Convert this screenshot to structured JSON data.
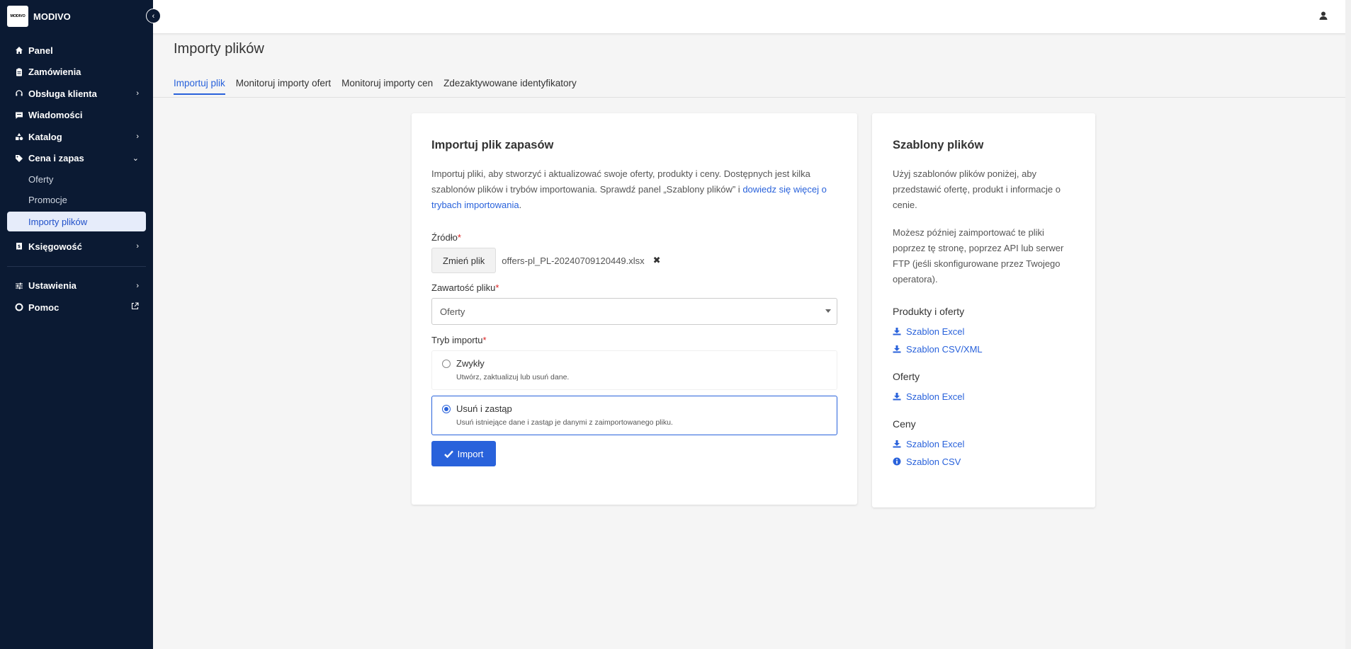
{
  "sidebar": {
    "brand": "MODIVO",
    "logo_text": "MODIVO",
    "items": [
      {
        "label": "Panel",
        "icon": "home-icon"
      },
      {
        "label": "Zamówienia",
        "icon": "clipboard-icon"
      },
      {
        "label": "Obsługa klienta",
        "icon": "headset-icon",
        "chevron": "right"
      },
      {
        "label": "Wiadomości",
        "icon": "message-icon"
      },
      {
        "label": "Katalog",
        "icon": "shapes-icon",
        "chevron": "right"
      },
      {
        "label": "Cena i zapas",
        "icon": "tag-icon",
        "chevron": "down"
      }
    ],
    "sub_items": [
      "Oferty",
      "Promocje",
      "Importy plików"
    ],
    "items_after": [
      {
        "label": "Księgowość",
        "icon": "receipt-icon",
        "chevron": "right"
      }
    ],
    "items_bottom": [
      {
        "label": "Ustawienia",
        "icon": "sliders-icon",
        "chevron": "right"
      },
      {
        "label": "Pomoc",
        "icon": "lifebuoy-icon",
        "external": true
      }
    ]
  },
  "page": {
    "title": "Importy plików",
    "tabs": [
      "Importuj plik",
      "Monitoruj importy ofert",
      "Monitoruj importy cen",
      "Zdezaktywowane identyfikatory"
    ],
    "active_tab": 0
  },
  "main_card": {
    "title": "Importuj plik zapasów",
    "desc_text": "Importuj pliki, aby stworzyć i aktualizować swoje oferty, produkty i ceny. Dostępnych jest kilka szablonów plików i trybów importowania. Sprawdź panel „Szablony plików” i ",
    "desc_link": "dowiedz się więcej o trybach importowania",
    "desc_end": ".",
    "source_label": "Źródło",
    "change_file_button": "Zmień plik",
    "file_name": "offers-pl_PL-20240709120449.xlsx",
    "content_label": "Zawartość pliku",
    "content_value": "Oferty",
    "mode_label": "Tryb importu",
    "modes": [
      {
        "label": "Zwykły",
        "desc": "Utwórz, zaktualizuj lub usuń dane.",
        "selected": false
      },
      {
        "label": "Usuń i zastąp",
        "desc": "Usuń istniejące dane i zastąp je danymi z zaimportowanego pliku.",
        "selected": true
      }
    ],
    "import_button": "Import"
  },
  "side_card": {
    "title": "Szablony plików",
    "p1": "Użyj szablonów plików poniżej, aby przedstawić ofertę, produkt i informacje o cenie.",
    "p2": "Możesz później zaimportować te pliki poprzez tę stronę, poprzez API lub serwer FTP (jeśli skonfigurowane przez Twojego operatora).",
    "sections": [
      {
        "title": "Produkty i oferty",
        "links": [
          {
            "label": "Szablon Excel",
            "icon": "download-icon"
          },
          {
            "label": "Szablon CSV/XML",
            "icon": "download-icon"
          }
        ]
      },
      {
        "title": "Oferty",
        "links": [
          {
            "label": "Szablon Excel",
            "icon": "download-icon"
          }
        ]
      },
      {
        "title": "Ceny",
        "links": [
          {
            "label": "Szablon Excel",
            "icon": "download-icon"
          },
          {
            "label": "Szablon CSV",
            "icon": "info-icon"
          }
        ]
      }
    ]
  },
  "colors": {
    "sidebar_bg": "#0b1a33",
    "accent": "#2962db",
    "required": "#dd2222"
  }
}
